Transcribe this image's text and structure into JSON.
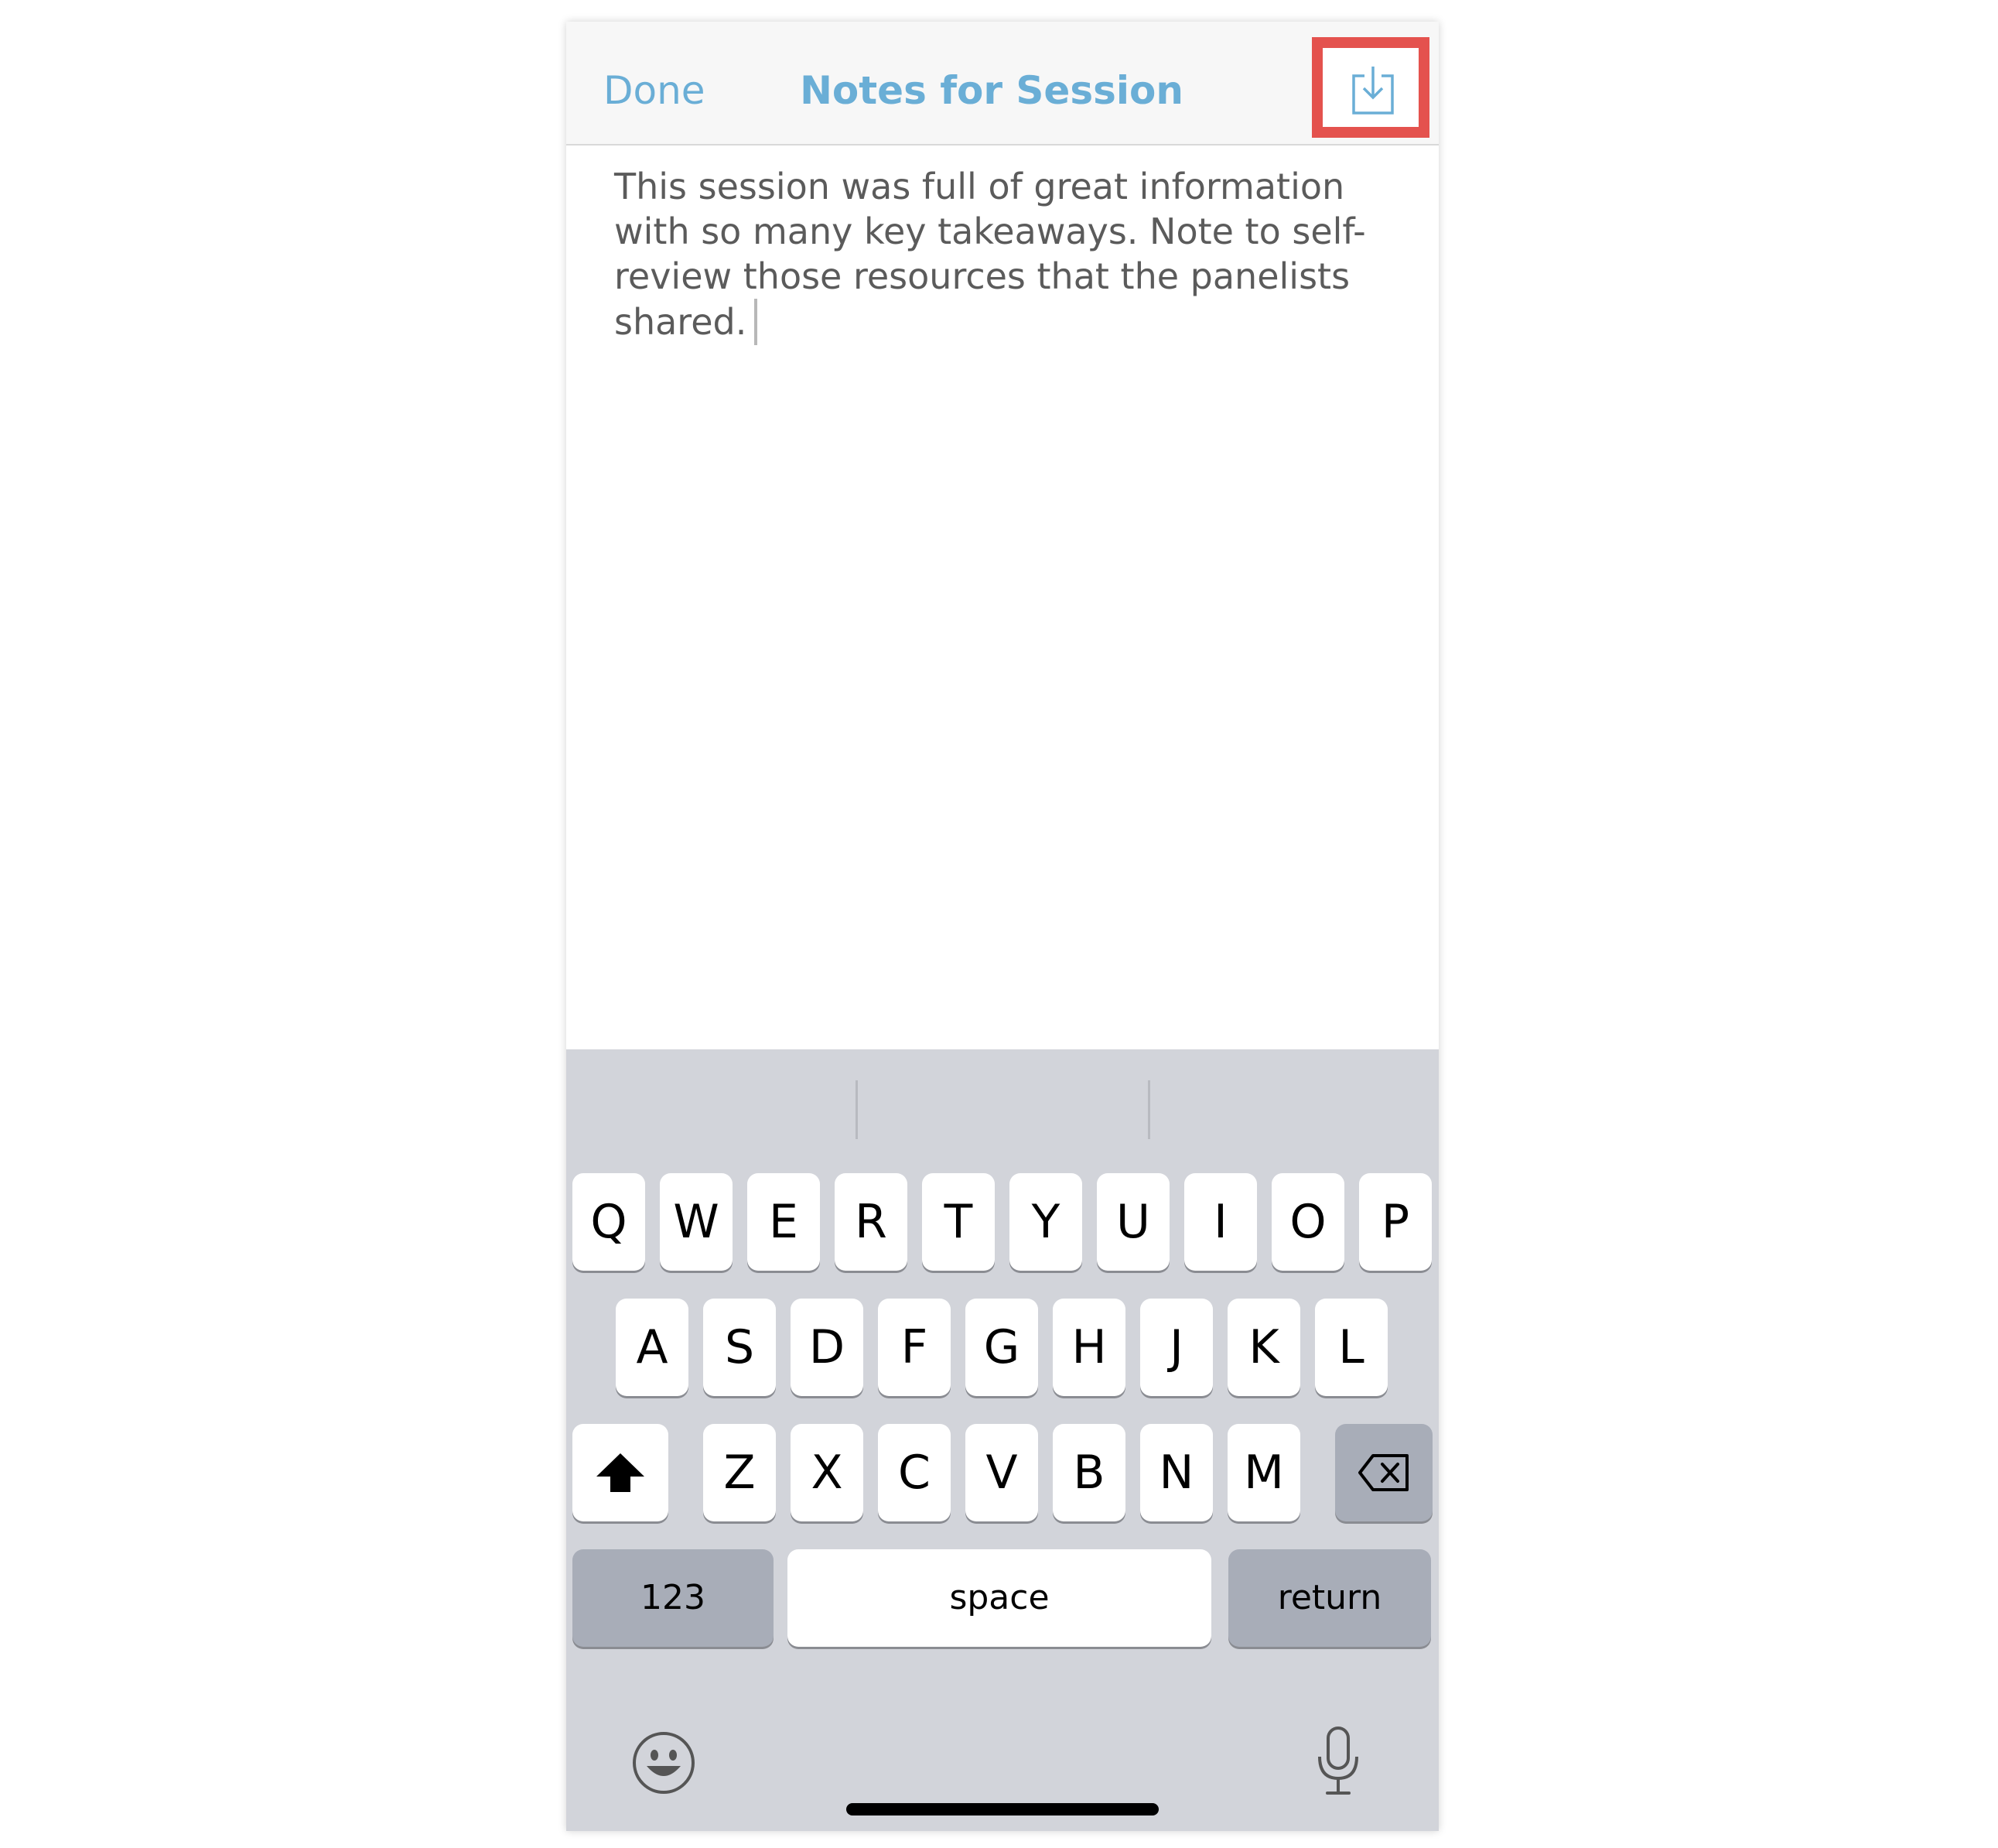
{
  "navbar": {
    "done_label": "Done",
    "title": "Notes for Session",
    "export_icon": "export-download-icon"
  },
  "note": {
    "text": "This session was full of great information with so many key takeaways. Note to self- review those resources that the panelists shared."
  },
  "keyboard": {
    "row1": [
      "Q",
      "W",
      "E",
      "R",
      "T",
      "Y",
      "U",
      "I",
      "O",
      "P"
    ],
    "row2": [
      "A",
      "S",
      "D",
      "F",
      "G",
      "H",
      "J",
      "K",
      "L"
    ],
    "row3": [
      "Z",
      "X",
      "C",
      "V",
      "B",
      "N",
      "M"
    ],
    "numbers_label": "123",
    "space_label": "space",
    "return_label": "return",
    "shift_icon": "shift-icon",
    "delete_icon": "backspace-icon",
    "emoji_icon": "emoji-icon",
    "mic_icon": "microphone-icon"
  },
  "colors": {
    "accent": "#6aaed6",
    "highlight": "#e4524e",
    "keyboard_bg": "#d2d4da"
  }
}
